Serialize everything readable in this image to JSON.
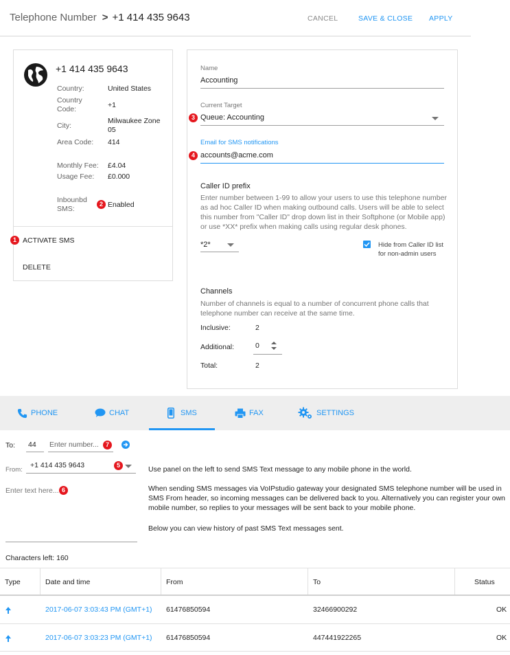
{
  "header": {
    "breadcrumb_parent": "Telephone Number",
    "breadcrumb_sep": ">",
    "breadcrumb_current": "+1 414 435 9643",
    "cancel": "CANCEL",
    "save_close": "SAVE & CLOSE",
    "apply": "APPLY"
  },
  "number_card": {
    "phone": "+1 414 435 9643",
    "country_label": "Country:",
    "country_value": "United States",
    "country_code_label": "Country Code:",
    "country_code_value": "+1",
    "city_label": "City:",
    "city_value": "Milwaukee Zone 05",
    "area_code_label": "Area Code:",
    "area_code_value": "414",
    "monthly_fee_label": "Monthly Fee:",
    "monthly_fee_value": "£4.04",
    "usage_fee_label": "Usage Fee:",
    "usage_fee_value": "£0.000",
    "inbound_sms_label": "Inbounbd SMS:",
    "inbound_sms_value": "Enabled",
    "activate_sms": "ACTIVATE SMS",
    "delete": "DELETE"
  },
  "badges": {
    "b1": "1",
    "b2": "2",
    "b3": "3",
    "b4": "4",
    "b5": "5",
    "b6": "6",
    "b7": "7"
  },
  "settings": {
    "name_label": "Name",
    "name_value": "Accounting",
    "target_label": "Current Target",
    "target_value": "Queue: Accounting",
    "email_label": "Email for SMS notifications",
    "email_value": "accounts@acme.com",
    "callerid_title": "Caller ID prefix",
    "callerid_desc": "Enter number between 1-99 to allow your users to use this telephone number as ad hoc Caller ID when making outbound calls. Users will be able to select this number from \"Caller ID\" drop down list in their Softphone (or Mobile app) or use *XX* prefix when making calls using regular desk phones.",
    "prefix_value": "*2*",
    "hide_label": "Hide from Caller ID list for non-admin users",
    "hide_checked": true,
    "channels_title": "Channels",
    "channels_desc": "Number of channels is equal to a number of concurrent phone calls that telephone number can receive at the same time.",
    "inclusive_label": "Inclusive:",
    "inclusive_value": "2",
    "additional_label": "Additional:",
    "additional_value": "0",
    "total_label": "Total:",
    "total_value": "2"
  },
  "tabs": {
    "phone": "PHONE",
    "chat": "CHAT",
    "sms": "SMS",
    "fax": "FAX",
    "settings": "SETTINGS",
    "active": "SMS"
  },
  "sms": {
    "to_label": "To:",
    "to_code": "44",
    "to_placeholder": "Enter number...",
    "from_label": "From:",
    "from_value": "+1 414 435 9643",
    "text_placeholder": "Enter text here...",
    "chars_left": "Characters left: 160",
    "para1": "Use panel on the left to send SMS Text message to any mobile phone in the world.",
    "para2": "When sending SMS messages via VoIPstudio gateway your designated SMS telephone number will be used in SMS From header, so incoming messages can be delivered back to you. Alternatively you can register your own mobile number, so replies to your messages will be sent back to your mobile phone.",
    "para3": "Below you can view history of past SMS Text messages sent."
  },
  "history": {
    "columns": [
      "Type",
      "Date and time",
      "From",
      "To",
      "Status"
    ],
    "rows": [
      {
        "date": "2017-06-07 3:03:43 PM (GMT+1)",
        "from": "61476850594",
        "to": "32466900292",
        "status": "OK"
      },
      {
        "date": "2017-06-07 3:03:23 PM (GMT+1)",
        "from": "61476850594",
        "to": "447441922265",
        "status": "OK"
      }
    ]
  },
  "colors": {
    "accent": "#2196f3",
    "badge": "#e5171e",
    "tabbar": "#eeeeee"
  }
}
